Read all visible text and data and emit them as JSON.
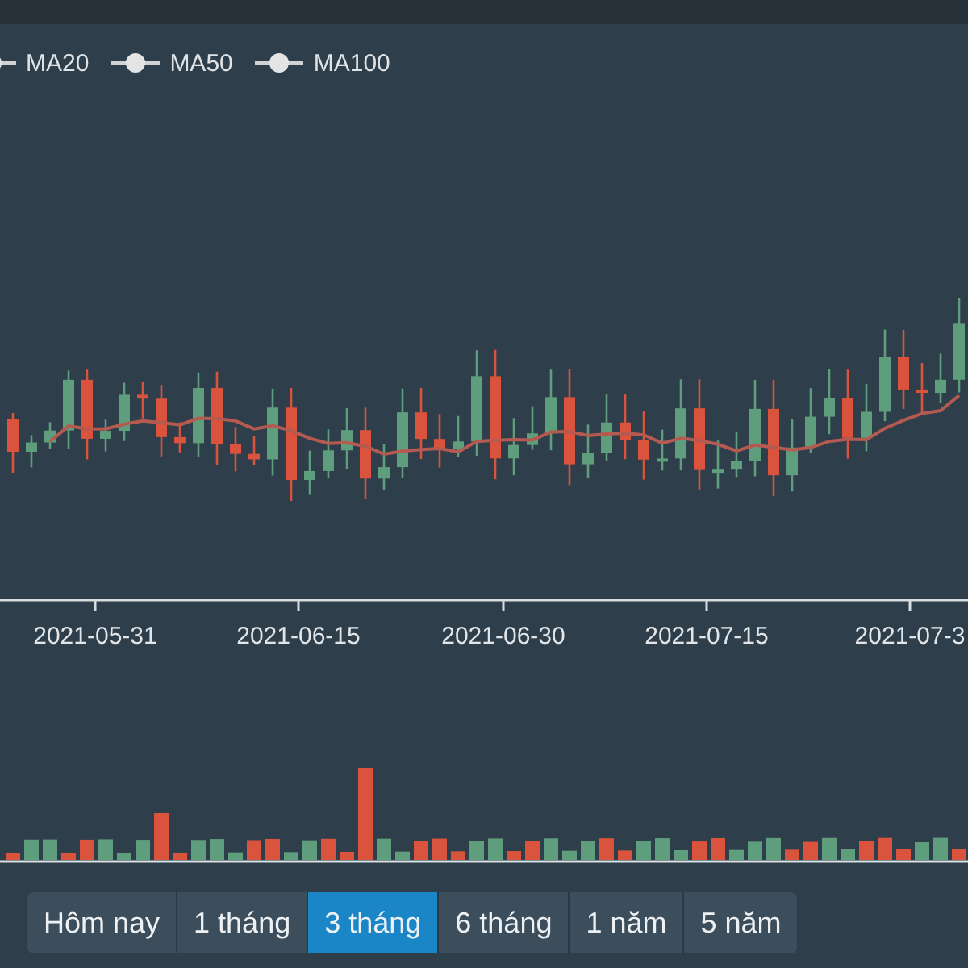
{
  "legend": [
    {
      "label": "MA20"
    },
    {
      "label": "MA50"
    },
    {
      "label": "MA100"
    }
  ],
  "x_axis_labels": [
    "2021-05-31",
    "2021-06-15",
    "2021-06-30",
    "2021-07-15",
    "2021-07-3"
  ],
  "range_buttons": [
    {
      "label": "Hôm nay",
      "selected": false
    },
    {
      "label": "1 tháng",
      "selected": false
    },
    {
      "label": "3 tháng",
      "selected": true
    },
    {
      "label": "6 tháng",
      "selected": false
    },
    {
      "label": "1 năm",
      "selected": false
    },
    {
      "label": "5 năm",
      "selected": false
    }
  ]
}
